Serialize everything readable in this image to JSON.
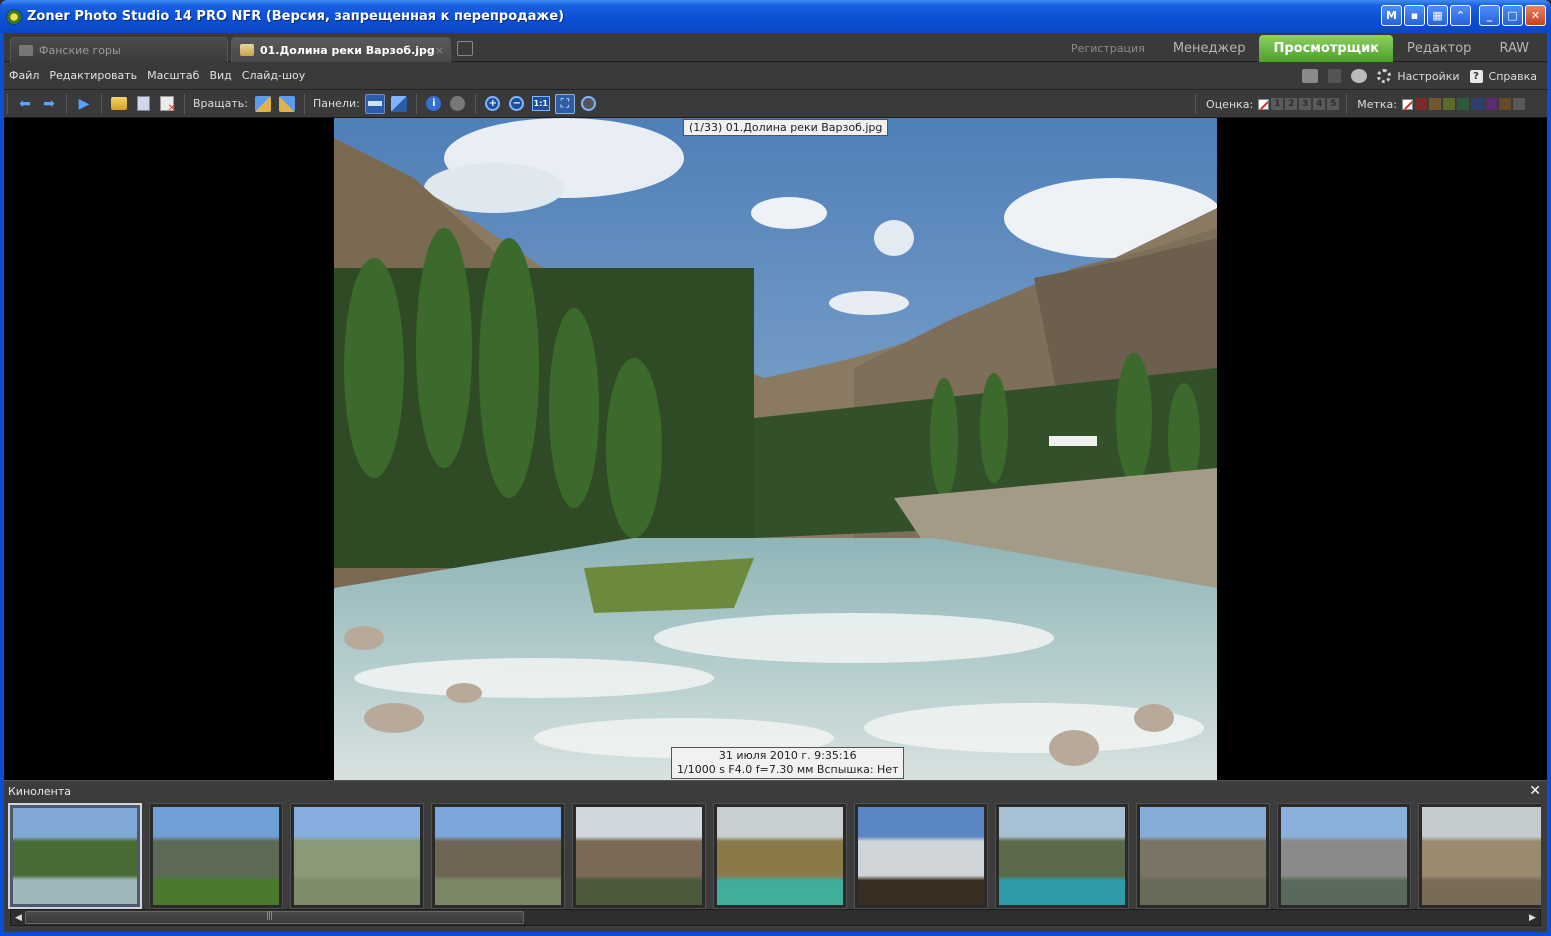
{
  "window": {
    "title": "Zoner Photo Studio 14 PRO NFR (Версия, запрещенная к перепродаже)"
  },
  "tabs": {
    "folder_tab": "Фанские горы",
    "file_tab": "01.Долина реки Варзоб.jpg",
    "close_symbol": "×"
  },
  "modes": {
    "registration": "Регистрация",
    "manager": "Менеджер",
    "viewer": "Просмотрщик",
    "editor": "Редактор",
    "raw": "RAW"
  },
  "menu": {
    "items": [
      "Файл",
      "Редактировать",
      "Масштаб",
      "Вид",
      "Слайд-шоу"
    ],
    "settings": "Настройки",
    "help": "Справка"
  },
  "toolbar": {
    "rotate_label": "Вращать:",
    "panels_label": "Панели:",
    "info_symbol": "i",
    "zoom_in_symbol": "+",
    "zoom_out_symbol": "−",
    "zoom_11": "1:1",
    "rating_label": "Оценка:",
    "rating_values": [
      "1",
      "2",
      "3",
      "4",
      "5"
    ],
    "label_label": "Метка:",
    "label_colors": [
      "#7a2a2a",
      "#6e5a2a",
      "#5c6a2c",
      "#2c5a3a",
      "#2c3f6e",
      "#5a2c6e",
      "#6a4a2c",
      "#5a5a5a",
      "#3a3a3a"
    ]
  },
  "viewer": {
    "top_caption": "(1/33) 01.Долина реки Варзоб.jpg",
    "date_line": "31 июля 2010 г. 9:35:16",
    "exif_line": "1/1000 s F4.0  f=7.30 мм Вспышка: Нет"
  },
  "filmstrip": {
    "title": "Кинолента",
    "close_symbol": "✕",
    "thumbnail_count": 11,
    "selected_index": 0
  },
  "scrollbar": {
    "left_arrow": "◀",
    "right_arrow": "▶"
  }
}
